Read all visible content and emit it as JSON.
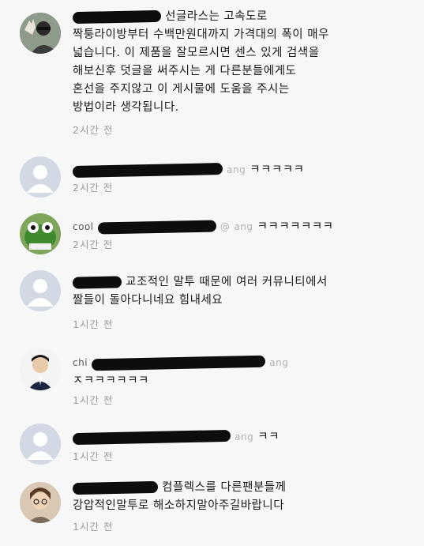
{
  "comments": [
    {
      "lines": [
        "선글라스는 고속도로",
        "짝퉁라이방부터 수백만원대까지 가격대의 폭이 매우",
        "넓습니다. 이 제품을 잘모르시면 센스 있게 검색을",
        "해보신후 덧글을 써주시는 게 다른분들에게도",
        "혼선을 주지않고 이 게시물에 도움을 주시는",
        "방법이라 생각됩니다."
      ],
      "time": "2시간 전"
    },
    {
      "text": "ㅋㅋㅋㅋㅋ",
      "tail": "ang",
      "time": "2시간 전"
    },
    {
      "text": "ㅋㅋㅋㅋㅋㅋㅋ",
      "name": "cool",
      "mention": "@",
      "tail": "ang",
      "time": "2시간 전"
    },
    {
      "text": "교조적인 말투 때문에 여러 커뮤니티에서",
      "line2": "짤들이 돌아다니네요 힘내세요",
      "time": "1시간 전"
    },
    {
      "text": "ㅈㅋㅋㅋㅋㅋㅋ",
      "name": "chi",
      "tail": "ang",
      "time": "1시간 전"
    },
    {
      "text": "ㅋㅋ",
      "tail": "ang",
      "time": "1시간 전"
    },
    {
      "text": "컴플렉스를 다른팬분들께",
      "line2": "강압적인말투로 해소하지말아주길바랍니다",
      "time": "1시간 전"
    }
  ]
}
